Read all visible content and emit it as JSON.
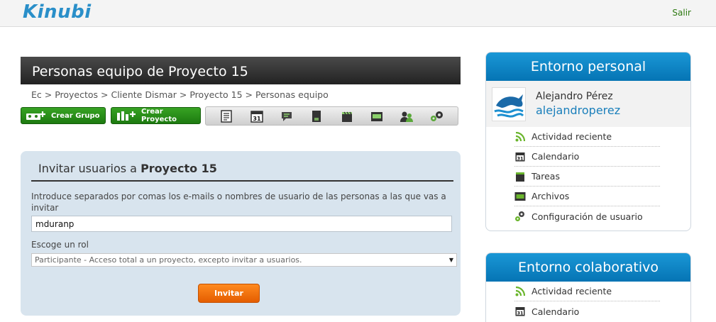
{
  "header": {
    "logo_text": "Kinubi",
    "logout_label": "Salir"
  },
  "page": {
    "title": "Personas equipo de Proyecto 15",
    "breadcrumb": [
      "Ec",
      "Proyectos",
      "Cliente Dismar",
      "Proyecto 15",
      "Personas equipo"
    ],
    "breadcrumb_separator": " > "
  },
  "toolbar": {
    "create_group_label": "Crear Grupo",
    "create_project_label": "Crear Proyecto",
    "tools": [
      "document-icon",
      "calendar-icon",
      "comments-icon",
      "notes-icon",
      "clapboard-icon",
      "files-icon",
      "users-icon",
      "settings-icon"
    ]
  },
  "invite": {
    "title_prefix": "Invitar usuarios a ",
    "title_project": "Proyecto 15",
    "instructions": "Introduce separados por comas los e-mails o nombres de usuario de las personas a las que vas a invitar",
    "email_value": "mduranp",
    "role_label": "Escoge un rol",
    "role_selected": "Participante - Acceso total a un proyecto, excepto invitar a usuarios.",
    "submit_label": "Invitar"
  },
  "personal": {
    "title": "Entorno personal",
    "user_name": "Alejandro Pérez",
    "username": "alejandroperez",
    "items": [
      {
        "label": "Actividad reciente",
        "icon": "rss-icon"
      },
      {
        "label": "Calendario",
        "icon": "calendar-icon"
      },
      {
        "label": "Tareas",
        "icon": "tasks-icon"
      },
      {
        "label": "Archivos",
        "icon": "folder-icon"
      },
      {
        "label": "Configuración de usuario",
        "icon": "gears-icon"
      }
    ]
  },
  "collab": {
    "title": "Entorno colaborativo",
    "items": [
      {
        "label": "Actividad reciente",
        "icon": "rss-icon"
      },
      {
        "label": "Calendario",
        "icon": "calendar-icon"
      }
    ]
  },
  "colors": {
    "green": "#2e8a18",
    "blue": "#0a82c4",
    "orange": "#f07014"
  }
}
